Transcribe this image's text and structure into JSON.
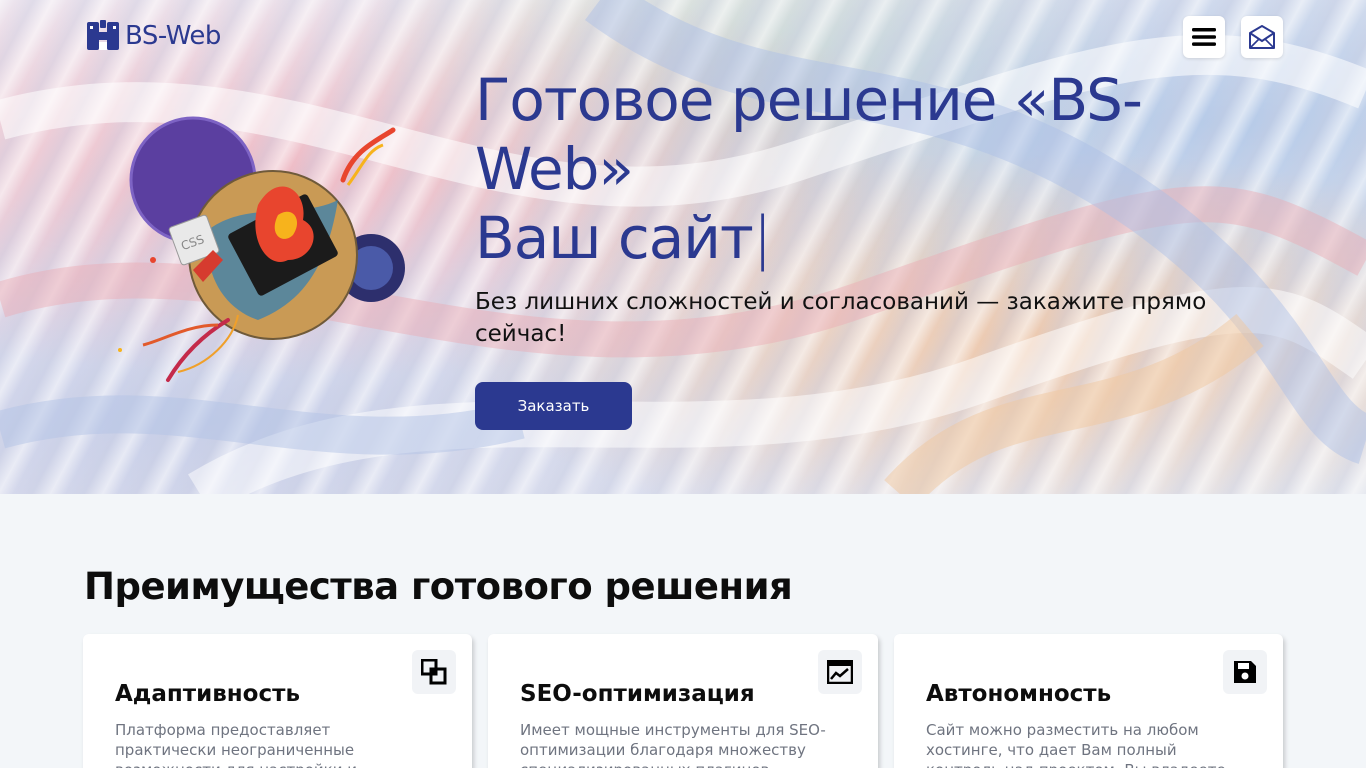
{
  "header": {
    "logo_text": "BS-Web",
    "menu_icon": "hamburger-menu-icon",
    "mail_icon": "envelope-icon"
  },
  "hero": {
    "title_line1": "Готовое решение «BS-",
    "title_line2": "Web»",
    "title_line3": "Ваш сайт",
    "caret": "|",
    "subtitle": "Без лишних сложностей и согласований — закажите прямо сейчас!",
    "order_button": "Заказать"
  },
  "advantages": {
    "title": "Преимущества готового решения",
    "cards": [
      {
        "icon": "layers-icon",
        "title": "Адаптивность",
        "text": "Платформа предоставляет практически неограниченные возможности для настройки и расширения функционала"
      },
      {
        "icon": "chart-icon",
        "title": "SEO-оптимизация",
        "text": "Имеет мощные инструменты для SEO-оптимизации благодаря множеству специализированных плагинов"
      },
      {
        "icon": "save-disk-icon",
        "title": "Автономность",
        "text": "Сайт можно разместить на любом хостинге, что дает Вам полный контроль над проектом. Вы владеете всеми"
      }
    ]
  },
  "colors": {
    "brand": "#2b3990",
    "section_bg": "#f3f6f9",
    "card_bg": "#ffffff"
  }
}
